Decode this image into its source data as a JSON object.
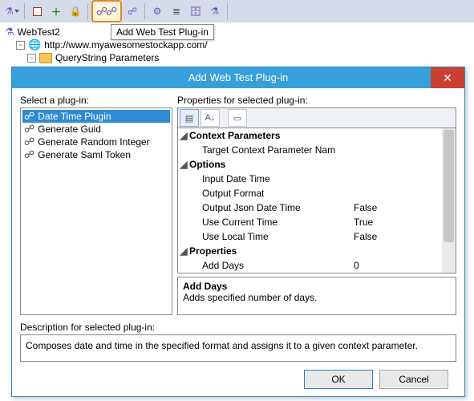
{
  "toolbar": {
    "tooltip": "Add Web Test Plug-in"
  },
  "tree": {
    "root": "WebTest2",
    "url": "http://www.myawesomestockapp.com/",
    "qsp": "QueryString Parameters"
  },
  "dialog": {
    "title": "Add Web Test Plug-in",
    "select_label": "Select a plug-in:",
    "props_label": "Properties for selected plug-in:",
    "desc_label": "Description for selected plug-in:",
    "plugins": {
      "0": "Date Time Plugin",
      "1": "Generate Guid",
      "2": "Generate Random Integer",
      "3": "Generate Saml Token"
    },
    "props": {
      "cat0": "Context Parameters",
      "p0k": "Target Context Parameter Nam",
      "cat1": "Options",
      "p1k": "Input Date Time",
      "p2k": "Output Format",
      "p3k": "Output Json Date Time",
      "p3v": "False",
      "p4k": "Use Current Time",
      "p4v": "True",
      "p5k": "Use Local Time",
      "p5v": "False",
      "cat2": "Properties",
      "p6k": "Add Days",
      "p6v": "0"
    },
    "help_name": "Add Days",
    "help_desc": "Adds specified number of days.",
    "description": "Composes date and time in the specified format and assigns it to a given context parameter.",
    "ok": "OK",
    "cancel": "Cancel"
  }
}
